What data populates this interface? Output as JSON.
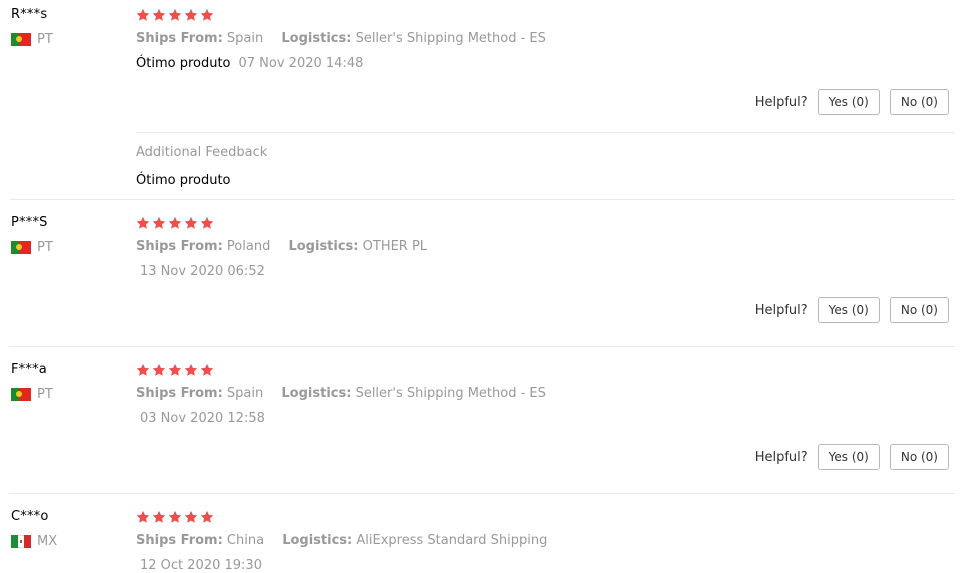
{
  "colors": {
    "star": "#f04e4e",
    "muted": "#999999",
    "flag_pt_green": "#1e8a2e",
    "flag_pt_red": "#e0281f"
  },
  "labels": {
    "ships_from": "Ships From:",
    "logistics": "Logistics:",
    "helpful": "Helpful?",
    "additional_feedback": "Additional Feedback"
  },
  "reviews": [
    {
      "user": "R***s",
      "country": "PT",
      "flag_icon": "portugal-flag-icon",
      "rating": 5,
      "ships_from": "Spain",
      "logistics": "Seller's Shipping Method - ES",
      "feedback": "Ótimo produto",
      "date": "07 Nov 2020 14:48",
      "yes": "Yes (0)",
      "no": "No (0)",
      "additional_feedback": "Ótimo produto"
    },
    {
      "user": "P***S",
      "country": "PT",
      "flag_icon": "portugal-flag-icon",
      "rating": 5,
      "ships_from": "Poland",
      "logistics": "OTHER PL",
      "feedback": "",
      "date": "13 Nov 2020 06:52",
      "yes": "Yes (0)",
      "no": "No (0)"
    },
    {
      "user": "F***a",
      "country": "PT",
      "flag_icon": "portugal-flag-icon",
      "rating": 5,
      "ships_from": "Spain",
      "logistics": "Seller's Shipping Method - ES",
      "feedback": "",
      "date": "03 Nov 2020 12:58",
      "yes": "Yes (0)",
      "no": "No (0)"
    },
    {
      "user": "C***o",
      "country": "MX",
      "flag_icon": "mexico-flag-icon",
      "rating": 5,
      "ships_from": "China",
      "logistics": "AliExpress Standard Shipping",
      "feedback": "",
      "date": "12 Oct 2020 19:30"
    }
  ]
}
